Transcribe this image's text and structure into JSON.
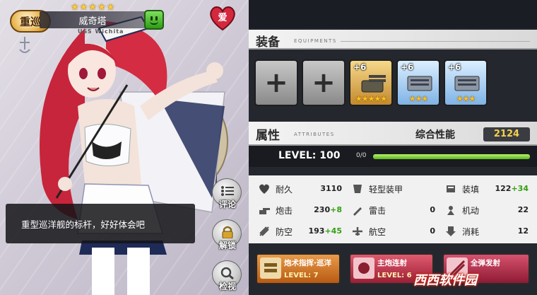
{
  "character": {
    "type_badge": "重巡",
    "name": "威奇塔",
    "ship_code": "USS Wichita",
    "rarity_stars": "★★★★★",
    "mood_icon": "smile-face-icon",
    "affection_label": "爱",
    "quote": "重型巡洋舰的标杆，好好体会吧"
  },
  "side_buttons": [
    {
      "label": "评论",
      "icon": "comment-list-icon"
    },
    {
      "label": "解锁",
      "icon": "padlock-icon"
    },
    {
      "label": "检视",
      "icon": "magnifier-icon"
    }
  ],
  "equipment": {
    "title": "装备",
    "subtitle": "EQUIPMENTS",
    "slots": [
      {
        "kind": "empty",
        "label": "+"
      },
      {
        "kind": "empty",
        "label": "+"
      },
      {
        "kind": "gold",
        "enhance": "+6",
        "stars": "★★★★★",
        "icon": "turret-gun-icon"
      },
      {
        "kind": "blue",
        "enhance": "+6",
        "stars": "★★★",
        "icon": "anti-air-gun-icon"
      },
      {
        "kind": "blue",
        "enhance": "+6",
        "stars": "★★★",
        "icon": "anti-air-gun-icon"
      }
    ]
  },
  "attributes": {
    "title": "属性",
    "subtitle": "ATTRIBUTES",
    "performance_label": "综合性能",
    "performance_value": "2124",
    "level_text": "LEVEL: 100",
    "exp_text": "0/0",
    "exp_fraction": 1.0,
    "stats": [
      {
        "name": "耐久",
        "value": "3110",
        "bonus": "",
        "icon": "heart-icon"
      },
      {
        "name": "轻型装甲",
        "value": "",
        "bonus": "",
        "icon": "armor-icon"
      },
      {
        "name": "装填",
        "value": "122",
        "bonus": "+34",
        "icon": "reload-icon"
      },
      {
        "name": "炮击",
        "value": "230",
        "bonus": "+8",
        "icon": "cannon-icon"
      },
      {
        "name": "雷击",
        "value": "0",
        "bonus": "",
        "icon": "torpedo-icon"
      },
      {
        "name": "机动",
        "value": "22",
        "bonus": "",
        "icon": "evasion-icon"
      },
      {
        "name": "防空",
        "value": "193",
        "bonus": "+45",
        "icon": "anti-air-icon"
      },
      {
        "name": "航空",
        "value": "0",
        "bonus": "",
        "icon": "aviation-icon"
      },
      {
        "name": "消耗",
        "value": "12",
        "bonus": "",
        "icon": "fuel-cost-icon"
      }
    ]
  },
  "skills": [
    {
      "name": "炮术指挥·巡洋",
      "level": "LEVEL: 7",
      "color": "#d8731f"
    },
    {
      "name": "主炮连射",
      "level": "LEVEL: 6",
      "color": "#c0334a"
    },
    {
      "name": "全弹发射",
      "level": "",
      "color": "#b82c4c"
    }
  ],
  "watermark": "西西软件园"
}
